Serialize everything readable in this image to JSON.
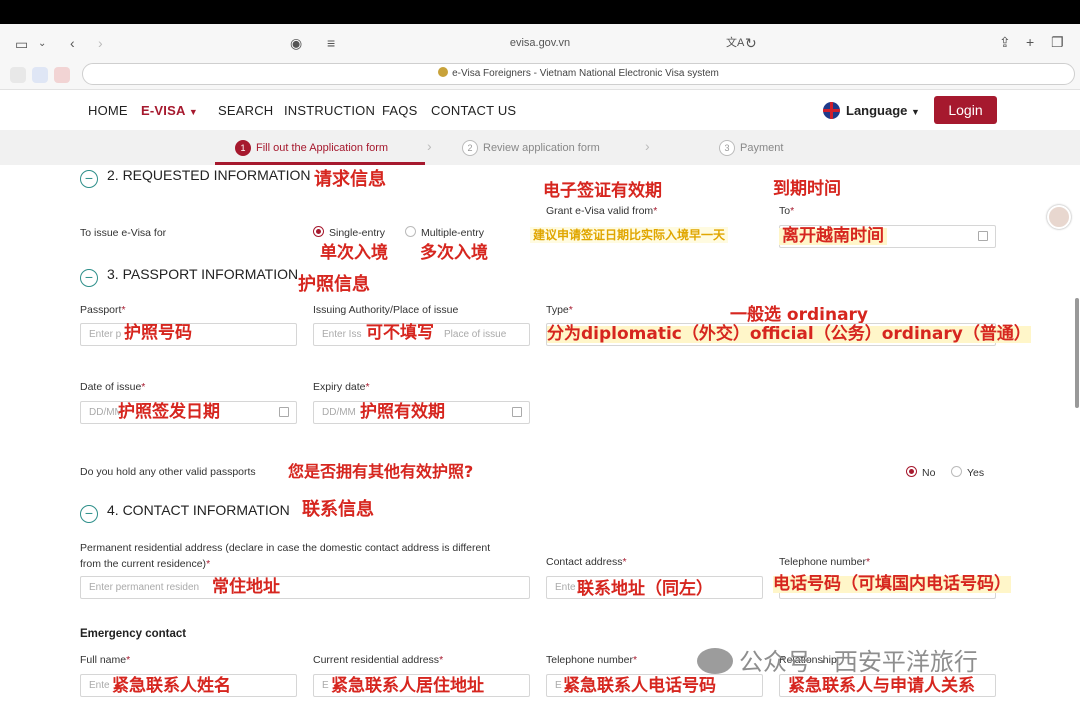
{
  "browser": {
    "domain": "evisa.gov.vn",
    "tab_title": "e-Visa Foreigners - Vietnam National Electronic Visa system"
  },
  "nav": {
    "home": "HOME",
    "evisa": "E-VISA",
    "search": "SEARCH",
    "instruction": "INSTRUCTION",
    "faqs": "FAQS",
    "contact": "CONTACT US",
    "language": "Language",
    "login": "Login"
  },
  "steps": [
    {
      "num": "1",
      "label": "Fill out the Application form"
    },
    {
      "num": "2",
      "label": "Review application form"
    },
    {
      "num": "3",
      "label": "Payment"
    }
  ],
  "requested": {
    "title": "2. REQUESTED INFORMATION",
    "issue_for": "To issue e-Visa for",
    "single": "Single-entry",
    "multiple": "Multiple-entry",
    "valid_from": "Grant e-Visa valid from",
    "to": "To",
    "req_mark": "*"
  },
  "passport": {
    "title": "3. PASSPORT INFORMATION",
    "passport_label": "Passport",
    "passport_ph": "Enter p",
    "authority_label": "Issuing Authority/Place of issue",
    "authority_ph": "Enter Iss",
    "authority_ph2": "Place of issue",
    "type_label": "Type",
    "issue_date_label": "Date of issue",
    "issue_date_ph": "DD/MM",
    "expiry_label": "Expiry date",
    "expiry_ph": "DD/MM",
    "other_q": "Do you hold any other valid passports",
    "no": "No",
    "yes": "Yes"
  },
  "contact": {
    "title": "4. CONTACT INFORMATION",
    "perm_label_1": "Permanent residential address (declare in case the domestic contact address is different",
    "perm_label_2": "from the current residence)",
    "perm_ph": "Enter permanent residen",
    "contact_addr": "Contact address",
    "contact_ph": "Ente",
    "phone": "Telephone number",
    "emergency": "Emergency contact",
    "full_name": "Full name",
    "full_name_ph": "Ente",
    "current_addr": "Current residential address",
    "current_ph": "E",
    "phone2": "Telephone number",
    "phone2_ph": "E",
    "relationship": "Relationship"
  },
  "annotations": {
    "requested": "请求信息",
    "valid_period": "电子签证有效期",
    "expire_time": "到期时间",
    "suggest": "建议申请签证日期比实际入境早一天",
    "leave_time": "离开越南时间",
    "single": "单次入境",
    "multiple": "多次入境",
    "passport_info": "护照信息",
    "ordinary_hint": "一般选 ordinary",
    "passport_no": "护照号码",
    "optional": "可不填写",
    "types": "分为diplomatic（外交）official（公务）ordinary（普通）",
    "issue_date": "护照签发日期",
    "expiry": "护照有效期",
    "other_passport": "您是否拥有其他有效护照?",
    "contact_info": "联系信息",
    "perm_addr": "常住地址",
    "contact_addr": "联系地址（同左）",
    "phone": "电话号码（可填国内电话号码）",
    "em_name": "紧急联系人姓名",
    "em_addr": "紧急联系人居住地址",
    "em_phone": "紧急联系人电话号码",
    "em_rel": "紧急联系人与申请人关系"
  },
  "watermark": "公众号 · 西安平洋旅行"
}
